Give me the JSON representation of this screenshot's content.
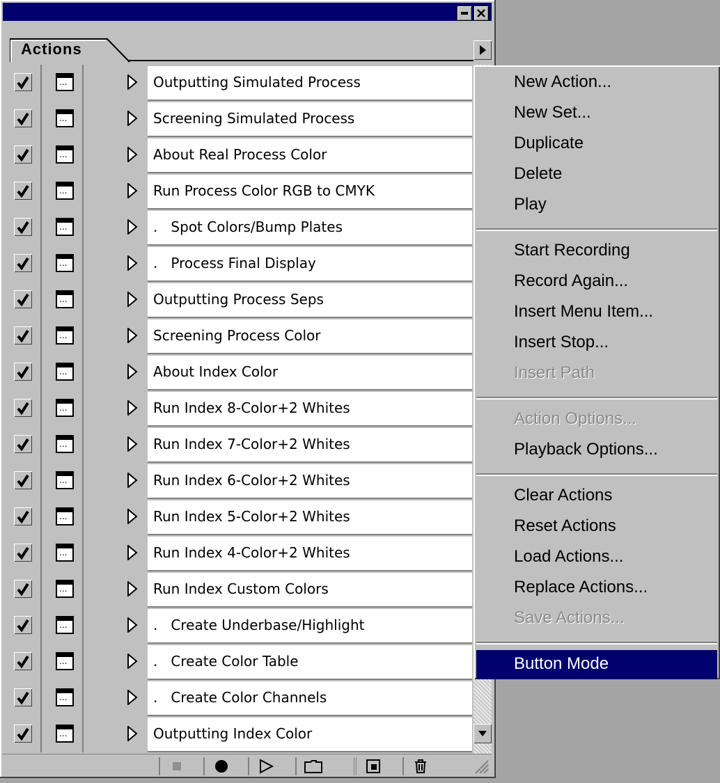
{
  "palette": {
    "tab_label": "Actions",
    "actions": [
      {
        "label": "Outputting Simulated Process",
        "checked": true
      },
      {
        "label": "Screening Simulated Process",
        "checked": true
      },
      {
        "label": "About Real Process Color",
        "checked": true
      },
      {
        "label": "Run Process Color RGB to CMYK",
        "checked": true
      },
      {
        "label": ".   Spot Colors/Bump Plates",
        "checked": true
      },
      {
        "label": ".   Process Final Display",
        "checked": true
      },
      {
        "label": "Outputting Process Seps",
        "checked": true
      },
      {
        "label": "Screening Process Color",
        "checked": true
      },
      {
        "label": "About Index Color",
        "checked": true
      },
      {
        "label": "Run Index 8-Color+2 Whites",
        "checked": true
      },
      {
        "label": "Run Index 7-Color+2 Whites",
        "checked": true
      },
      {
        "label": "Run Index 6-Color+2 Whites",
        "checked": true
      },
      {
        "label": "Run Index 5-Color+2 Whites",
        "checked": true
      },
      {
        "label": "Run Index 4-Color+2 Whites",
        "checked": true
      },
      {
        "label": "Run Index Custom Colors",
        "checked": true
      },
      {
        "label": ".   Create Underbase/Highlight",
        "checked": true
      },
      {
        "label": ".   Create Color Table",
        "checked": true
      },
      {
        "label": ".   Create Color Channels",
        "checked": true
      },
      {
        "label": "Outputting Index Color",
        "checked": true
      }
    ],
    "toolbar_icons": [
      "stop-icon",
      "record-icon",
      "play-icon",
      "new-set-icon",
      "new-action-icon",
      "trash-icon"
    ]
  },
  "menu": {
    "groups": [
      [
        {
          "label": "New Action...",
          "enabled": true
        },
        {
          "label": "New Set...",
          "enabled": true
        },
        {
          "label": "Duplicate",
          "enabled": true
        },
        {
          "label": "Delete",
          "enabled": true
        },
        {
          "label": "Play",
          "enabled": true
        }
      ],
      [
        {
          "label": "Start Recording",
          "enabled": true
        },
        {
          "label": "Record Again...",
          "enabled": true
        },
        {
          "label": "Insert Menu Item...",
          "enabled": true
        },
        {
          "label": "Insert Stop...",
          "enabled": true
        },
        {
          "label": "Insert Path",
          "enabled": false
        }
      ],
      [
        {
          "label": "Action Options...",
          "enabled": false
        },
        {
          "label": "Playback Options...",
          "enabled": true
        }
      ],
      [
        {
          "label": "Clear Actions",
          "enabled": true
        },
        {
          "label": "Reset Actions",
          "enabled": true
        },
        {
          "label": "Load Actions...",
          "enabled": true
        },
        {
          "label": "Replace Actions...",
          "enabled": true
        },
        {
          "label": "Save Actions...",
          "enabled": false
        }
      ],
      [
        {
          "label": "Button Mode",
          "enabled": true,
          "highlighted": true
        }
      ]
    ]
  },
  "colors": {
    "titlebar": "#00006e",
    "highlight": "#00006e",
    "face": "#c0c0c0"
  }
}
